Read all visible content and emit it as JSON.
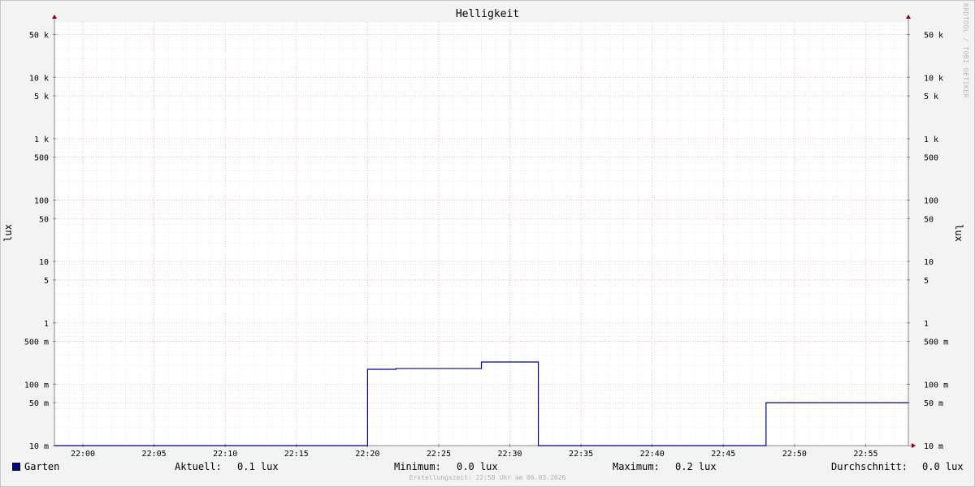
{
  "chart_data": {
    "type": "line",
    "title": "Helligkeit",
    "ylabel_left": "lux",
    "ylabel_right": "lux",
    "yscale": "log",
    "ylim": [
      0.01,
      80000
    ],
    "xlim": [
      "21:58",
      "22:58"
    ],
    "x_ticks": [
      "22:00",
      "22:05",
      "22:10",
      "22:15",
      "22:20",
      "22:25",
      "22:30",
      "22:35",
      "22:40",
      "22:45",
      "22:50",
      "22:55"
    ],
    "y_ticks": [
      {
        "value": 50000,
        "label": "50 k"
      },
      {
        "value": 10000,
        "label": "10 k"
      },
      {
        "value": 5000,
        "label": "5 k"
      },
      {
        "value": 1000,
        "label": "1 k"
      },
      {
        "value": 500,
        "label": "500"
      },
      {
        "value": 100,
        "label": "100"
      },
      {
        "value": 50,
        "label": "50"
      },
      {
        "value": 10,
        "label": "10"
      },
      {
        "value": 5,
        "label": "5"
      },
      {
        "value": 1,
        "label": "1"
      },
      {
        "value": 0.5,
        "label": "500 m"
      },
      {
        "value": 0.1,
        "label": "100 m"
      },
      {
        "value": 0.05,
        "label": "50 m"
      },
      {
        "value": 0.01,
        "label": "10 m"
      }
    ],
    "grid": true,
    "series": [
      {
        "name": "Garten",
        "color": "#00008b",
        "step": true,
        "points": [
          [
            "21:58",
            0.01
          ],
          [
            "22:20",
            0.01
          ],
          [
            "22:20",
            0.175
          ],
          [
            "22:22",
            0.175
          ],
          [
            "22:22",
            0.18
          ],
          [
            "22:28",
            0.18
          ],
          [
            "22:28",
            0.23
          ],
          [
            "22:32",
            0.23
          ],
          [
            "22:32",
            0.01
          ],
          [
            "22:48",
            0.01
          ],
          [
            "22:48",
            0.05
          ],
          [
            "22:58",
            0.05
          ]
        ]
      }
    ]
  },
  "legend": {
    "series_name": "Garten",
    "aktuell_label": "Aktuell:",
    "aktuell_value": "0.1 lux",
    "minimum_label": "Minimum:",
    "minimum_value": "0.0 lux",
    "maximum_label": "Maximum:",
    "maximum_value": "0.2 lux",
    "avg_label": "Durchschnitt:",
    "avg_value": "0.0 lux"
  },
  "footer": "Erstellungszeit: 22:58 Uhr am 06.03.2026",
  "watermark": "RRDTOOL / TOBI OETIKER"
}
